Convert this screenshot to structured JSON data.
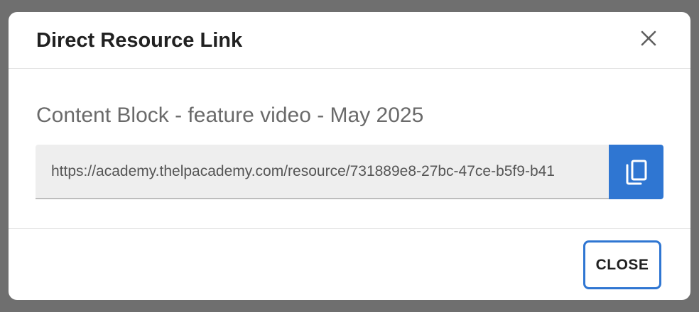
{
  "dialog": {
    "title": "Direct Resource Link",
    "close_icon": "close-icon",
    "resource_name": "Content Block - feature video - May 2025",
    "link_value": "https://academy.thelpacademy.com/resource/731889e8-27bc-47ce-b5f9-b41",
    "copy_icon": "copy-icon",
    "close_label": "CLOSE"
  },
  "colors": {
    "overlay": "#6f6f6f",
    "accent": "#2f76d2",
    "field_bg": "#eeeeee"
  }
}
